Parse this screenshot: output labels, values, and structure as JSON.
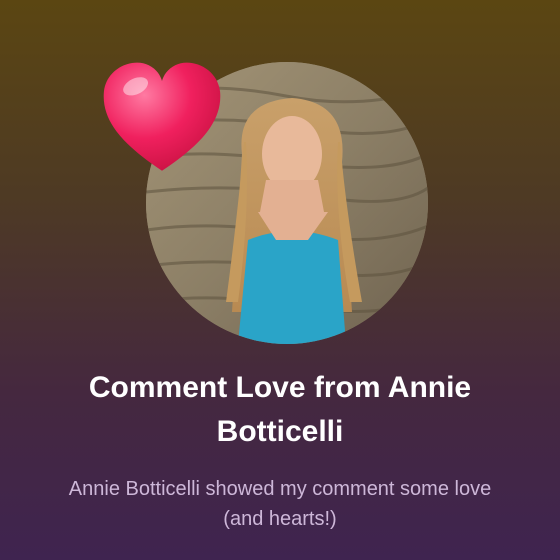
{
  "card": {
    "title": "Comment Love from Annie Botticelli",
    "subtitle": "Annie Botticelli showed my comment some love (and hearts!)"
  },
  "colors": {
    "background_top": "#5b4612",
    "background_bottom": "#3f2450",
    "heart": "#f0205e",
    "title_text": "#ffffff",
    "subtitle_text": "#cdb7d8"
  },
  "icons": {
    "heart": "heart-icon"
  }
}
